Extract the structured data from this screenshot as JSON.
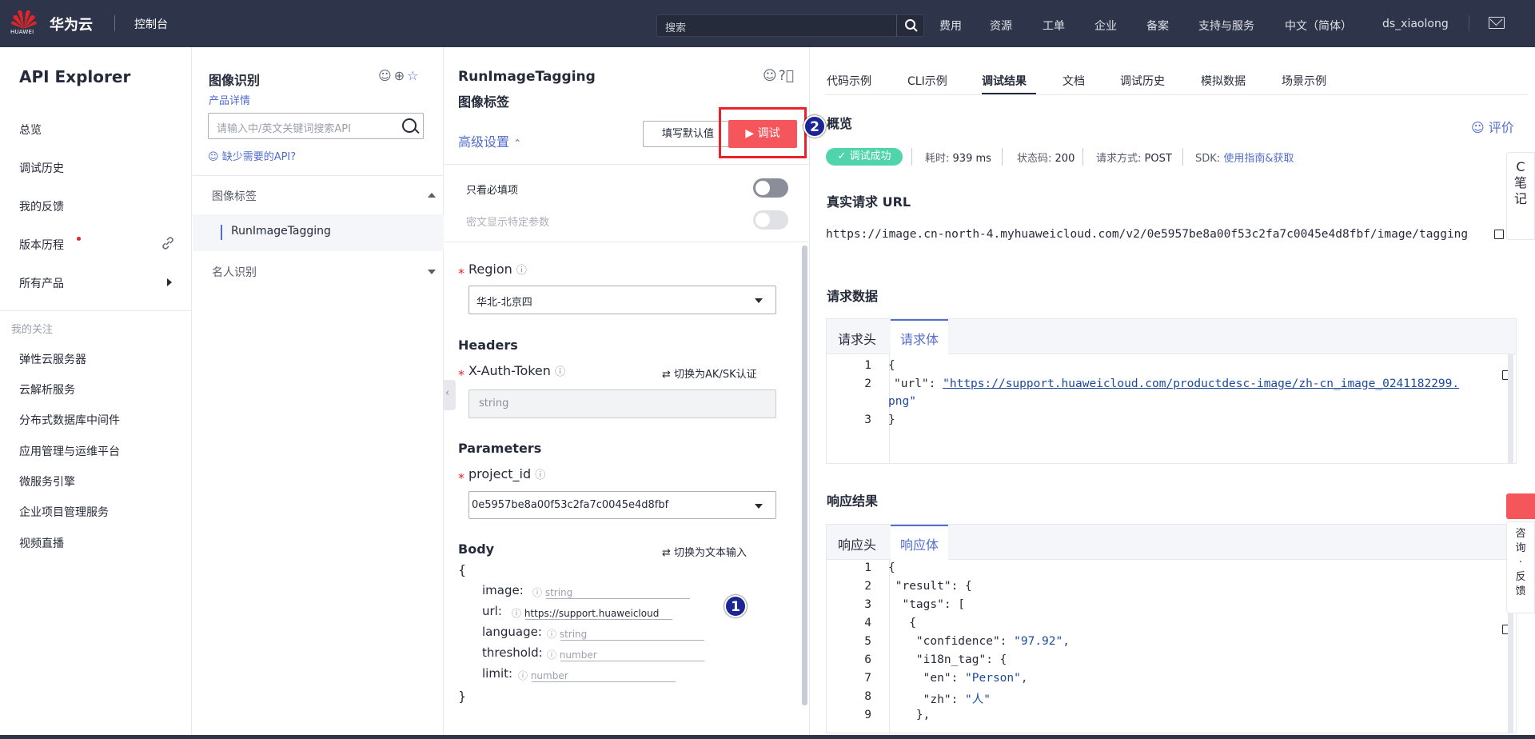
{
  "header": {
    "logo_text": "HUAWEI",
    "brand": "华为云",
    "console": "控制台",
    "search_placeholder": "搜索",
    "nav": [
      "费用",
      "资源",
      "工单",
      "企业",
      "备案",
      "支持与服务",
      "中文（简体）",
      "ds_xiaolong"
    ]
  },
  "sidebar": {
    "title": "API Explorer",
    "items": [
      "总览",
      "调试历史",
      "我的反馈",
      "版本历程",
      "所有产品"
    ],
    "section": "我的关注",
    "follows": [
      "弹性云服务器",
      "云解析服务",
      "分布式数据库中间件",
      "应用管理与运维平台",
      "微服务引擎",
      "企业项目管理服务",
      "视频直播"
    ]
  },
  "product": {
    "title": "图像识别",
    "detail": "产品详情",
    "search_placeholder": "请输入中/英文关键词搜索API",
    "missing": "缺少需要的API?",
    "groups": [
      "图像标签",
      "名人识别"
    ],
    "active_api": "RunImageTagging"
  },
  "api": {
    "name": "RunImageTagging",
    "subtitle": "图像标签",
    "advanced": "高级设置",
    "fill_default": "填写默认值",
    "debug": "调试",
    "only_required": "只看必填项",
    "cipher": "密文显示特定参数",
    "region_label": "Region",
    "region_value": "华北-北京四",
    "headers": "Headers",
    "token_label": "X-Auth-Token",
    "switch_aksk": "切换为AK/SK认证",
    "token_placeholder": "string",
    "parameters": "Parameters",
    "project_label": "project_id",
    "project_value": "0e5957be8a00f53c2fa7c0045e4d8fbf",
    "body": "Body",
    "switch_text": "切换为文本输入",
    "brace_open": "{",
    "brace_close": "}",
    "fields": [
      {
        "name": "image:",
        "value": "string"
      },
      {
        "name": "url:",
        "value": "https://support.huaweicloud"
      },
      {
        "name": "language:",
        "value": "string"
      },
      {
        "name": "threshold:",
        "value": "number"
      },
      {
        "name": "limit:",
        "value": "number"
      }
    ],
    "badge1": "1",
    "badge2": "2"
  },
  "result": {
    "tabs": [
      "代码示例",
      "CLI示例",
      "调试结果",
      "文档",
      "调试历史",
      "模拟数据",
      "场景示例"
    ],
    "overview": "概览",
    "rate": "评价",
    "status_badge": "调试成功",
    "time_label": "耗时:",
    "time_value": "939 ms",
    "code_label": "状态码:",
    "code_value": "200",
    "method_label": "请求方式:",
    "method_value": "POST",
    "sdk_label": "SDK:",
    "sdk_link": "使用指南&获取",
    "url_title": "真实请求 URL",
    "url": "https://image.cn-north-4.myhuaweicloud.com/v2/0e5957be8a00f53c2fa7c0045e4d8fbf/image/tagging",
    "request_title": "请求数据",
    "req_tab_head": "请求头",
    "req_tab_body": "请求体",
    "req_lines": [
      {
        "n": "1",
        "text": "{"
      },
      {
        "n": "2",
        "key": "\"url\"",
        "value": "\"https://support.huaweicloud.com/productdesc-image/zh-cn_image_0241182299.",
        "cont": "png\""
      },
      {
        "n": "3",
        "text": "}"
      }
    ],
    "response_title": "响应结果",
    "resp_tab_head": "响应头",
    "resp_tab_body": "响应体",
    "resp_lines": [
      {
        "n": "1",
        "text": "{"
      },
      {
        "n": "2",
        "text": " \"result\": {"
      },
      {
        "n": "3",
        "text": "  \"tags\": ["
      },
      {
        "n": "4",
        "text": "   {"
      },
      {
        "n": "5",
        "key": "    \"confidence\": ",
        "value": "\"97.92\","
      },
      {
        "n": "6",
        "text": "    \"i18n_tag\": {"
      },
      {
        "n": "7",
        "key": "     \"en\": ",
        "value": "\"Person\","
      },
      {
        "n": "8",
        "key": "     \"zh\": ",
        "value": "\"人\""
      },
      {
        "n": "9",
        "text": "    },"
      }
    ],
    "float_note": [
      "C",
      "笔",
      "记"
    ],
    "float_feedback": [
      "咨",
      "询",
      "·",
      "反",
      "馈"
    ]
  }
}
